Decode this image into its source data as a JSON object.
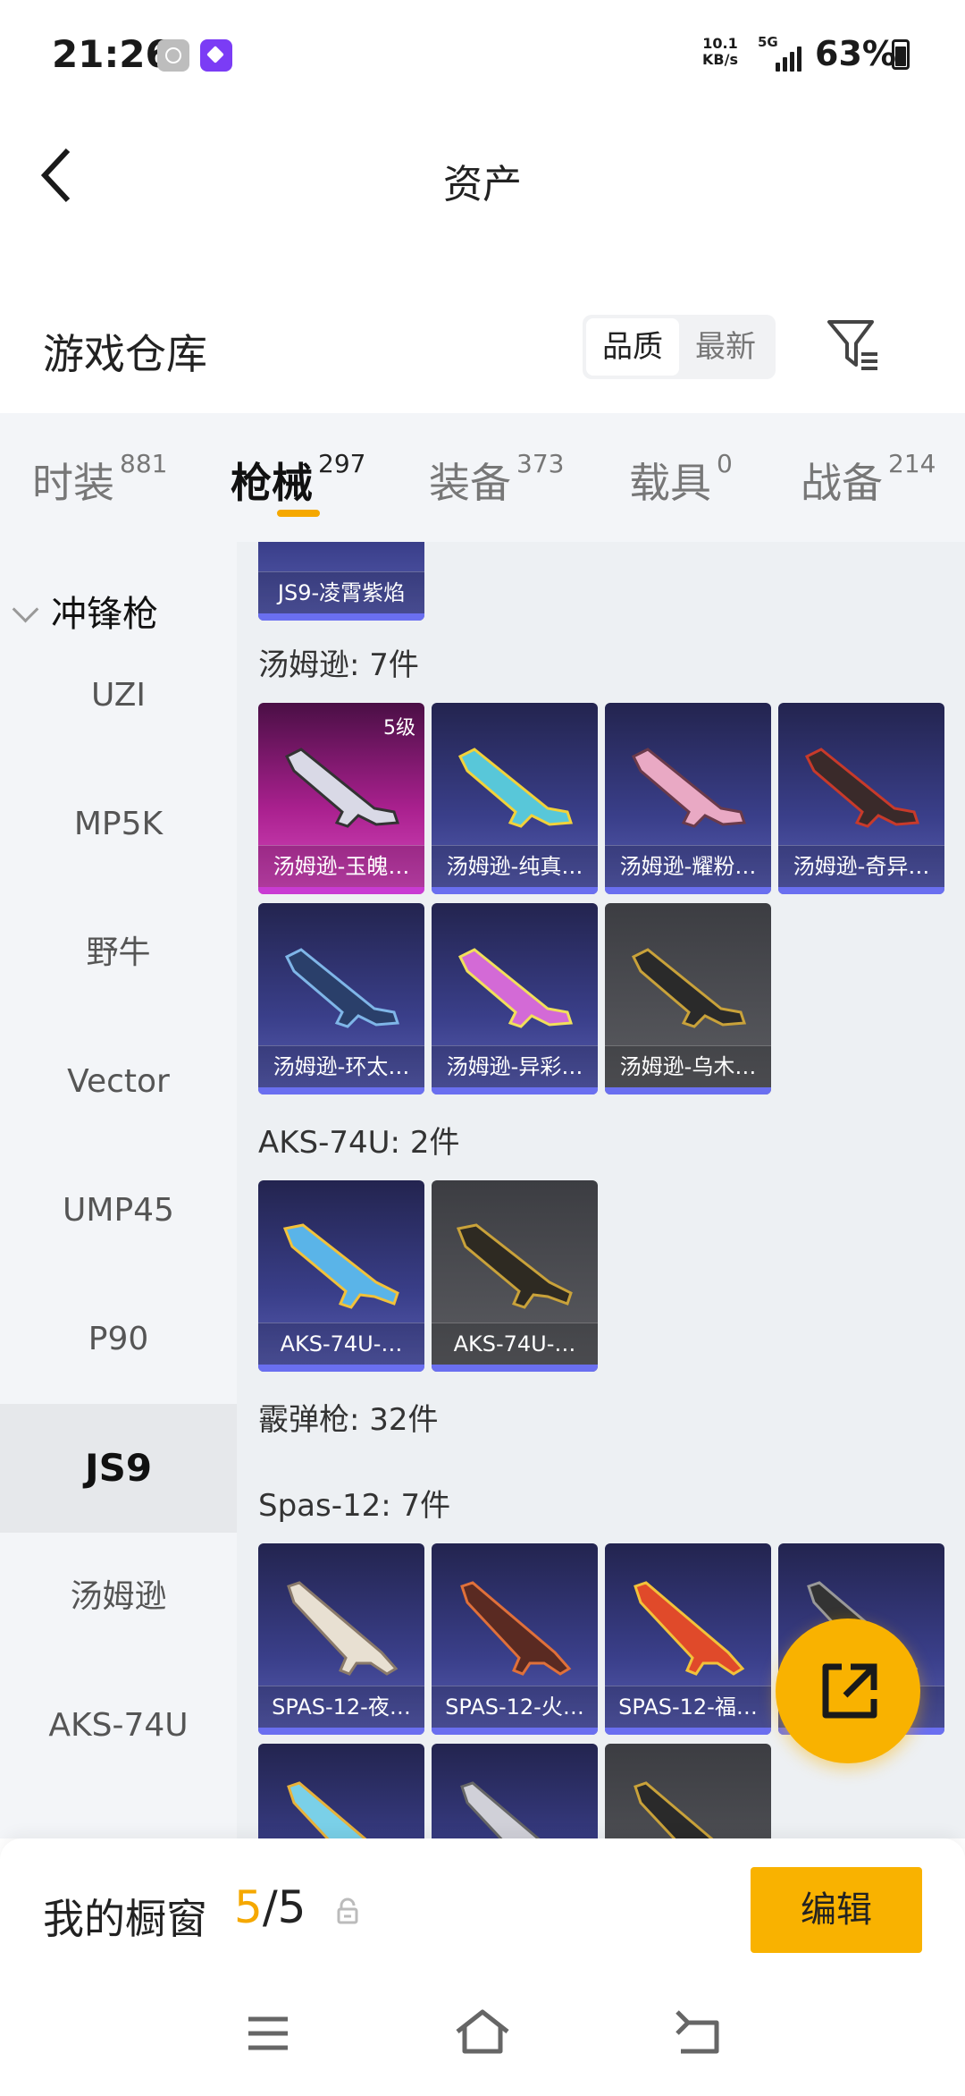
{
  "status_bar": {
    "time": "21:26",
    "net_speed": "10.1",
    "net_unit": "KB/s",
    "signal": "5G",
    "battery": "63%"
  },
  "header": {
    "title": "资产"
  },
  "warehouse": {
    "title": "游戏仓库",
    "sort_options": [
      "品质",
      "最新"
    ],
    "selected_sort": "品质"
  },
  "category_tabs": [
    {
      "label": "时装",
      "count": "881"
    },
    {
      "label": "枪械",
      "count": "297",
      "active": true
    },
    {
      "label": "装备",
      "count": "373"
    },
    {
      "label": "载具",
      "count": "0"
    },
    {
      "label": "战备",
      "count": "214"
    }
  ],
  "sidebar": {
    "section": "冲锋枪",
    "items": [
      "UZI",
      "MP5K",
      "野牛",
      "Vector",
      "UMP45",
      "P90",
      "JS9",
      "汤姆逊",
      "AKS-74U"
    ],
    "active": "JS9"
  },
  "content": {
    "partial_card": {
      "name": "JS9-凌霄紫焰"
    },
    "groups": [
      {
        "title": "汤姆逊: 7件",
        "cards": [
          {
            "name": "汤姆逊-玉魄…",
            "level": "5级",
            "style": "pink"
          },
          {
            "name": "汤姆逊-纯真…",
            "style": "purple"
          },
          {
            "name": "汤姆逊-耀粉…",
            "style": "purple"
          },
          {
            "name": "汤姆逊-奇异…",
            "style": "purple"
          },
          {
            "name": "汤姆逊-环太…",
            "style": "purple"
          },
          {
            "name": "汤姆逊-异彩…",
            "style": "purple"
          },
          {
            "name": "汤姆逊-乌木…",
            "style": "gray"
          }
        ]
      },
      {
        "title": "AKS-74U: 2件",
        "cards": [
          {
            "name": "AKS-74U-…",
            "style": "purple"
          },
          {
            "name": "AKS-74U-…",
            "style": "gray"
          }
        ]
      },
      {
        "title": "霰弹枪: 32件",
        "cards": []
      },
      {
        "title": "Spas-12: 7件",
        "cards": [
          {
            "name": "SPAS-12-夜…",
            "style": "purple"
          },
          {
            "name": "SPAS-12-火…",
            "style": "purple"
          },
          {
            "name": "SPAS-12-福…",
            "style": "purple"
          },
          {
            "name": "…",
            "style": "purple"
          }
        ]
      }
    ]
  },
  "showcase": {
    "label": "我的橱窗",
    "current": "5",
    "total": "/5",
    "edit_label": "编辑"
  },
  "colors": {
    "accent": "#f9b200",
    "tab_indicator": "#f5a800"
  },
  "icons": [
    "back-arrow-icon",
    "filter-icon",
    "share-export-icon",
    "lock-icon",
    "menu-icon",
    "home-icon",
    "back-icon"
  ]
}
